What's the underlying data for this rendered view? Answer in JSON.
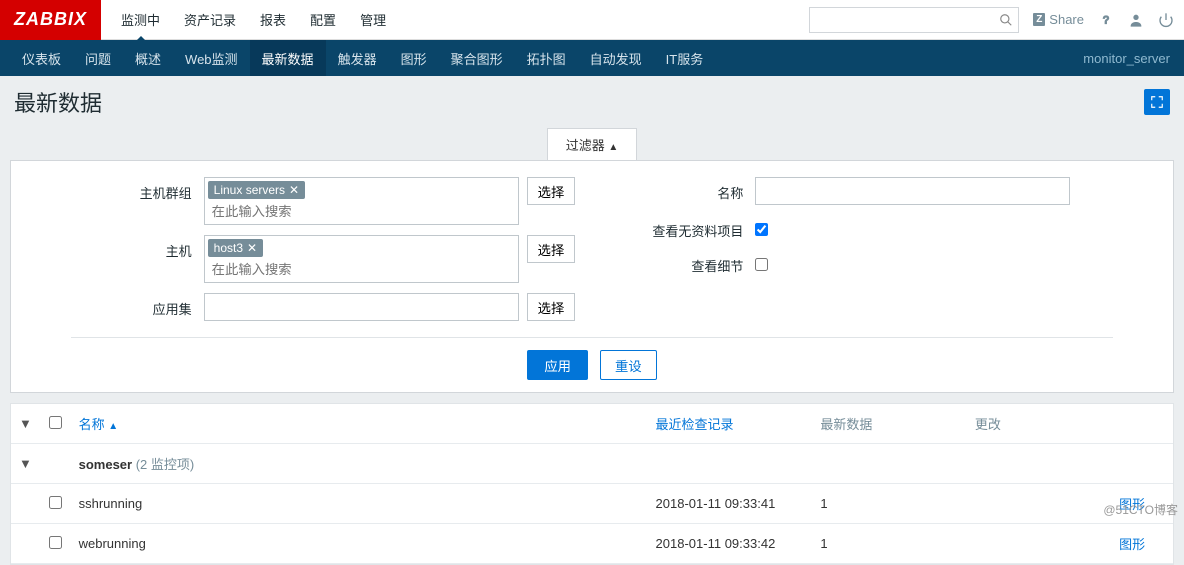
{
  "logo": "ZABBIX",
  "topmenu": [
    "监测中",
    "资产记录",
    "报表",
    "配置",
    "管理"
  ],
  "share": "Share",
  "subnav": [
    "仪表板",
    "问题",
    "概述",
    "Web监测",
    "最新数据",
    "触发器",
    "图形",
    "聚合图形",
    "拓扑图",
    "自动发现",
    "IT服务"
  ],
  "breadcrumb_right": "monitor_server",
  "page_title": "最新数据",
  "filter_tab": "过滤器",
  "filter": {
    "hostgroup_label": "主机群组",
    "hostgroup_tag": "Linux servers",
    "host_label": "主机",
    "host_tag": "host3",
    "app_label": "应用集",
    "placeholder": "在此输入搜索",
    "select_btn": "选择",
    "name_label": "名称",
    "nodata_label": "查看无资料项目",
    "details_label": "查看细节",
    "apply": "应用",
    "reset": "重设"
  },
  "table": {
    "headers": {
      "name": "名称",
      "lastcheck": "最近检查记录",
      "lastdata": "最新数据",
      "change": "更改"
    },
    "group": {
      "name": "someser",
      "count": "(2 监控项)"
    },
    "rows": [
      {
        "name": "sshrunning",
        "lastcheck": "2018-01-11 09:33:41",
        "lastdata": "1",
        "change": "",
        "link": "图形"
      },
      {
        "name": "webrunning",
        "lastcheck": "2018-01-11 09:33:42",
        "lastdata": "1",
        "change": "",
        "link": "图形"
      }
    ]
  },
  "watermark": "@51CTO博客"
}
